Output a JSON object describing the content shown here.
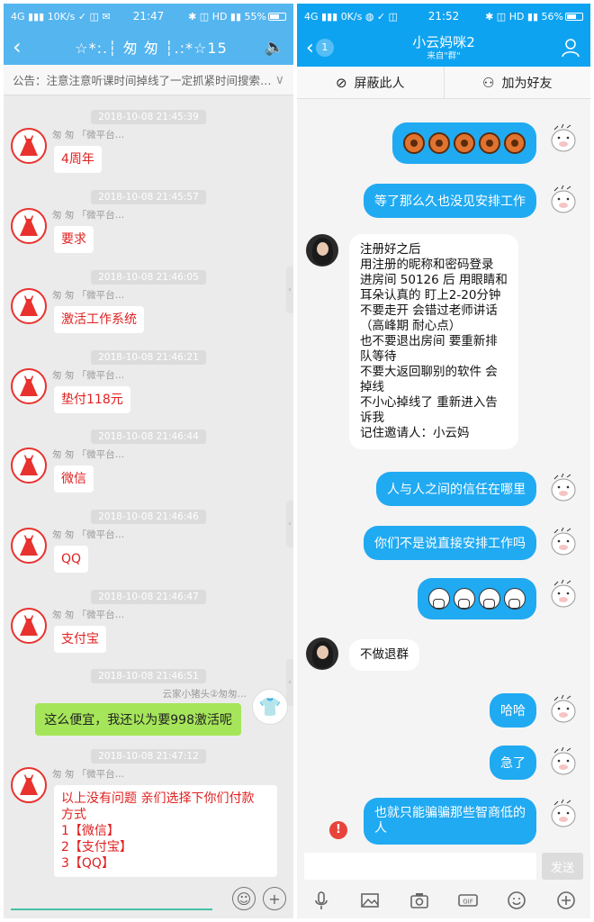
{
  "left": {
    "status": {
      "network": "4G",
      "speed": "10K/s",
      "time": "21:47",
      "hd": "HD",
      "battery": "55%"
    },
    "title": "☆*:.┆ 匆 匆 ┆.:*☆15",
    "notice": "公告：注意注意听课时间掉线了一定抓紧时间搜索…",
    "messages": [
      {
        "time": "2018-10-08 21:45:39",
        "sender": "匆  匆 「微平台…",
        "text": "4周年"
      },
      {
        "time": "2018-10-08 21:45:57",
        "sender": "匆  匆 「微平台…",
        "text": "要求"
      },
      {
        "time": "2018-10-08 21:46:05",
        "sender": "匆  匆 「微平台…",
        "text": "激活工作系统"
      },
      {
        "time": "2018-10-08 21:46:21",
        "sender": "匆  匆 「微平台…",
        "text": "垫付118元"
      },
      {
        "time": "2018-10-08 21:46:44",
        "sender": "匆  匆 「微平台…",
        "text": "微信"
      },
      {
        "time": "2018-10-08 21:46:46",
        "sender": "匆  匆 「微平台…",
        "text": "QQ"
      },
      {
        "time": "2018-10-08 21:46:47",
        "sender": "匆  匆 「微平台…",
        "text": "支付宝"
      }
    ],
    "my_message": {
      "time": "2018-10-08 21:46:51",
      "sender": "云家小猪头②匆匆…",
      "text": "这么便宜，我还以为要998激活呢"
    },
    "last_message": {
      "time": "2018-10-08 21:47:12",
      "sender": "匆  匆 「微平台…",
      "lines": [
        "以上没有问题    亲们选择下你们付款",
        "方式",
        "1【微信】",
        "2【支付宝】",
        "3【QQ】"
      ]
    }
  },
  "right": {
    "status": {
      "network": "4G",
      "speed": "0K/s",
      "time": "21:52",
      "hd": "HD",
      "battery": "56%"
    },
    "back_count": "1",
    "title": "小云妈咪2",
    "subtitle": "来自\"群\"",
    "actions": {
      "block": "屏蔽此人",
      "add_friend": "加为好友"
    },
    "messages": {
      "m2": "等了那么久也没见安排工作",
      "long_lines": [
        "注册好之后",
        "用注册的昵称和密码登录",
        "进房间 50126  后 用眼睛和",
        "耳朵认真的 盯上2-20分钟",
        "不要走开  会错过老师讲话",
        "（高峰期  耐心点）",
        "也不要退出房间  要重新排",
        "队等待",
        "不要大返回聊别的软件  会",
        "掉线",
        "不小心掉线了  重新进入告",
        "诉我",
        "记住邀请人：小云妈"
      ],
      "m4": "人与人之间的信任在哪里",
      "m5": "你们不是说直接安排工作吗",
      "m7": "不做退群",
      "m8": "哈哈",
      "m9": "急了",
      "m10_lines": [
        "也就只能骗骗那些智商低的",
        "人"
      ]
    },
    "send_label": "发送",
    "tools": [
      "mic-icon",
      "image-icon",
      "camera-icon",
      "gif-icon",
      "emoji-icon",
      "plus-icon"
    ]
  }
}
